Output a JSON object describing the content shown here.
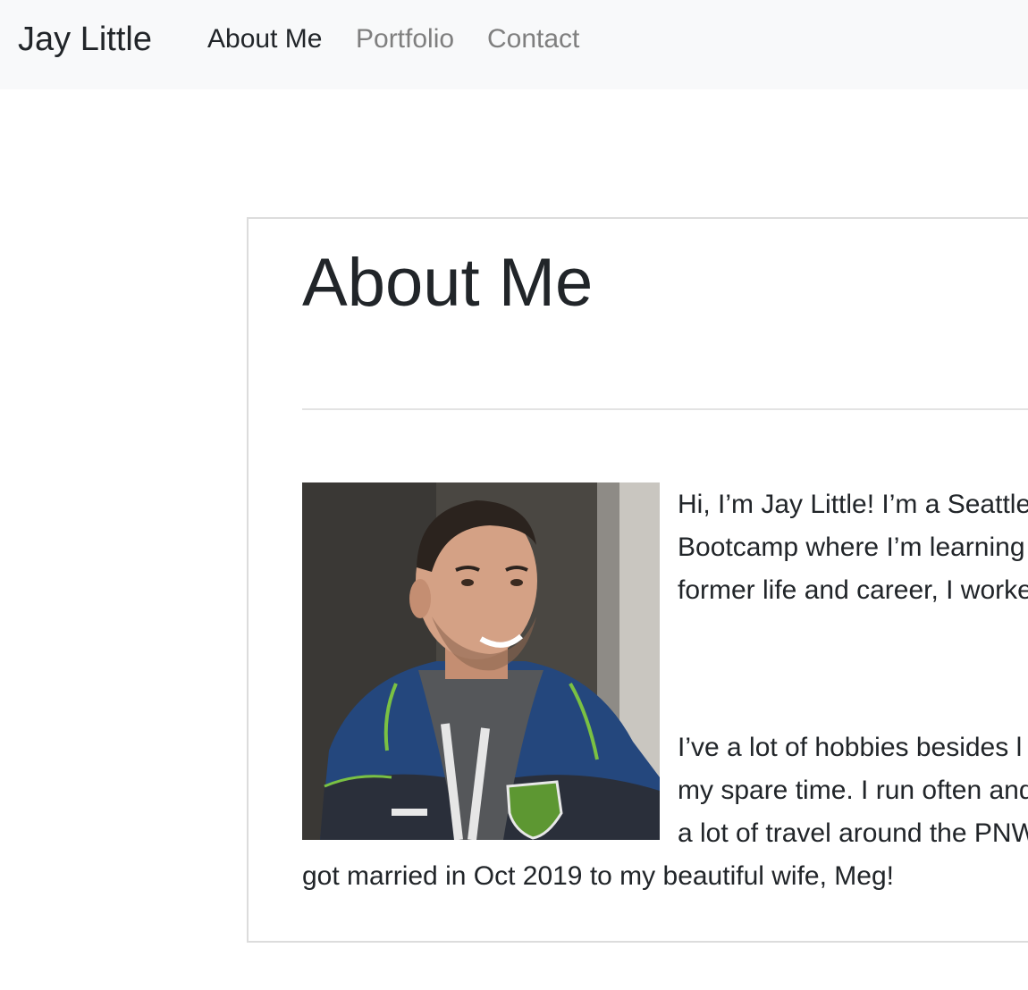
{
  "navbar": {
    "brand": "Jay Little",
    "links": [
      {
        "label": "About Me",
        "active": true
      },
      {
        "label": "Portfolio",
        "active": false
      },
      {
        "label": "Contact",
        "active": false
      }
    ]
  },
  "about": {
    "title": "About Me",
    "photo_icon": "profile-photo-man-in-blue-seattle-sounders-hoodie",
    "paragraph1_lines": [
      "Hi, I’m Jay Little! I’m a Seattle",
      "Bootcamp where I’m learning",
      "former life and career, I worke"
    ],
    "paragraph2_lines": [
      "I’ve a lot of hobbies besides l",
      "my spare time. I run often and",
      "a lot of travel around the PNW",
      "got married in Oct 2019 to my beautiful wife, Meg!"
    ]
  },
  "colors": {
    "navbar_bg": "#f8f9fa",
    "text": "#212529",
    "muted_link": "#7f7f7f",
    "card_border": "#dcdcdc"
  }
}
